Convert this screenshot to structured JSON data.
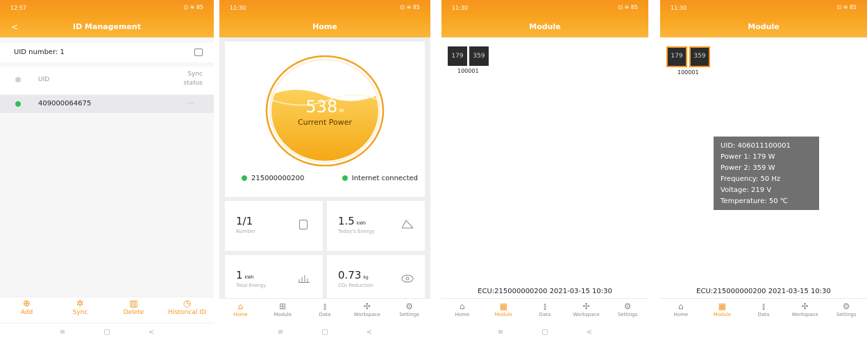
{
  "screens": {
    "id_management": {
      "status_time": "12:57",
      "status_right": "⊡ ≋ 85",
      "title": "ID Management",
      "uid_number_label": "UID number: 1",
      "col_uid": "UID",
      "col_sync": "Sync\nstatus",
      "row_uid": "409000064675",
      "row_sync": "---",
      "footer": {
        "add": "Add",
        "sync": "Sync",
        "delete": "Delete",
        "historical": "Historical ID"
      }
    },
    "home": {
      "status_time": "11:30",
      "status_right": "⊡ ≋ 85",
      "title": "Home",
      "power_value": "538",
      "power_unit": "W",
      "power_label": "Current Power",
      "ecu_id": "215000000200",
      "internet": "Internet connected",
      "tiles": {
        "number_value": "1/1",
        "number_label": "Number",
        "today_value": "1.5",
        "today_unit": "kWh",
        "today_label": "Today's Energy",
        "total_value": "1",
        "total_unit": "kWh",
        "total_label": "Total Energy",
        "co2_value": "0.73",
        "co2_unit": "kg",
        "co2_label": "CO₂ Reduction"
      },
      "nav": {
        "home": "Home",
        "module": "Module",
        "data": "Data",
        "workspace": "Workspace",
        "settings": "Settings"
      }
    },
    "module1": {
      "status_time": "11:30",
      "status_right": "⊡ ≋ 85",
      "title": "Module",
      "tile_a": "179",
      "tile_b": "359",
      "module_id": "100001",
      "ecu_line": "ECU:215000000200  2021-03-15 10:30"
    },
    "module2": {
      "status_time": "11:30",
      "status_right": "⊡ ≋ 85",
      "title": "Module",
      "tile_a": "179",
      "tile_b": "359",
      "module_id": "100001",
      "tooltip": {
        "uid": "UID: 406011100001",
        "p1": "Power 1: 179 W",
        "p2": "Power 2: 359 W",
        "freq": "Frequency: 50 Hz",
        "volt": "Voltage: 219 V",
        "temp": "Temperature: 50 ℃"
      },
      "ecu_line": "ECU:215000000200  2021-03-15 10:30"
    }
  },
  "colors": {
    "accent": "#f7941d",
    "green": "#2fbe52",
    "tooltip_bg": "#707070"
  },
  "icons": [
    "back-arrow-icon",
    "sim-icon",
    "plus-circle-icon",
    "sync-icon",
    "trash-icon",
    "clock-icon",
    "home-icon",
    "grid-icon",
    "bar-chart-icon",
    "workspace-icon",
    "gear-icon",
    "chip-icon",
    "curve-icon",
    "bars-icon",
    "leaf-icon"
  ]
}
